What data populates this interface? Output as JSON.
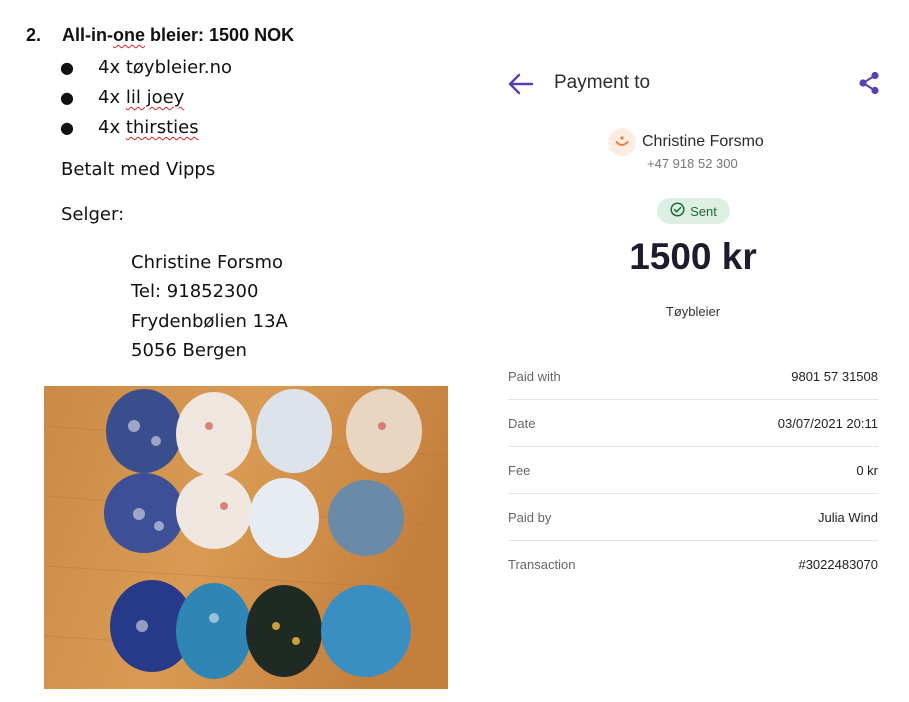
{
  "document": {
    "heading_number": "2.",
    "heading_parts": [
      "All-in-",
      "one",
      " bleier: 1500 NOK"
    ],
    "bullets": [
      {
        "prefix": "4x ",
        "text": "tøybleier.no"
      },
      {
        "prefix": "4x ",
        "text": "lil joey"
      },
      {
        "prefix": "4x ",
        "text": "thirsties"
      }
    ],
    "paid_with": "Betalt med Vipps",
    "seller_label": "Selger:",
    "seller": {
      "name": "Christine Forsmo",
      "phone": "Tel: 91852300",
      "street": "Frydenbølien 13A",
      "city": "5056 Bergen"
    }
  },
  "payment": {
    "title": "Payment to",
    "recipient_name": "Christine Forsmo",
    "recipient_phone": "+47 918 52 300",
    "status": "Sent",
    "amount": "1500 kr",
    "message": "Tøybleier",
    "details": [
      {
        "label": "Paid with",
        "value": "9801 57 31508"
      },
      {
        "label": "Date",
        "value": "03/07/2021 20:11"
      },
      {
        "label": "Fee",
        "value": "0 kr"
      },
      {
        "label": "Paid by",
        "value": "Julia Wind"
      },
      {
        "label": "Transaction",
        "value": "#3022483070"
      }
    ],
    "accent_color": "#5a3fb0",
    "status_color": "#1d6b3a",
    "icons": [
      "back-arrow-icon",
      "share-icon",
      "vipps-smile-icon",
      "check-circle-icon"
    ]
  }
}
